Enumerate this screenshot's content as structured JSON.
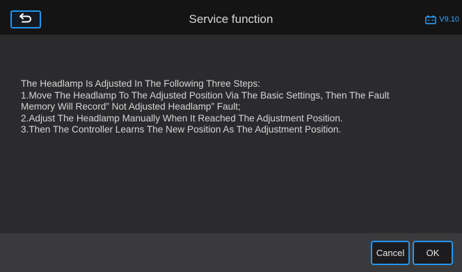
{
  "header": {
    "title": "Service function",
    "version": "V9.10",
    "back_icon": "back-arrow-icon",
    "battery_icon": "battery-icon",
    "accent_color": "#2196f3"
  },
  "content": {
    "lines": [
      "The Headlamp Is Adjusted In The Following Three Steps:",
      "1.Move The Headlamp To The Adjusted Position Via The Basic Settings, Then The Fault",
      "Memory Will Record” Not Adjusted Headlamp” Fault;",
      "2.Adjust The Headlamp Manually When It Reached The Adjustment Position.",
      "3.Then The Controller Learns The New Position As The Adjustment Position."
    ]
  },
  "footer": {
    "cancel_label": "Cancel",
    "ok_label": "OK"
  }
}
